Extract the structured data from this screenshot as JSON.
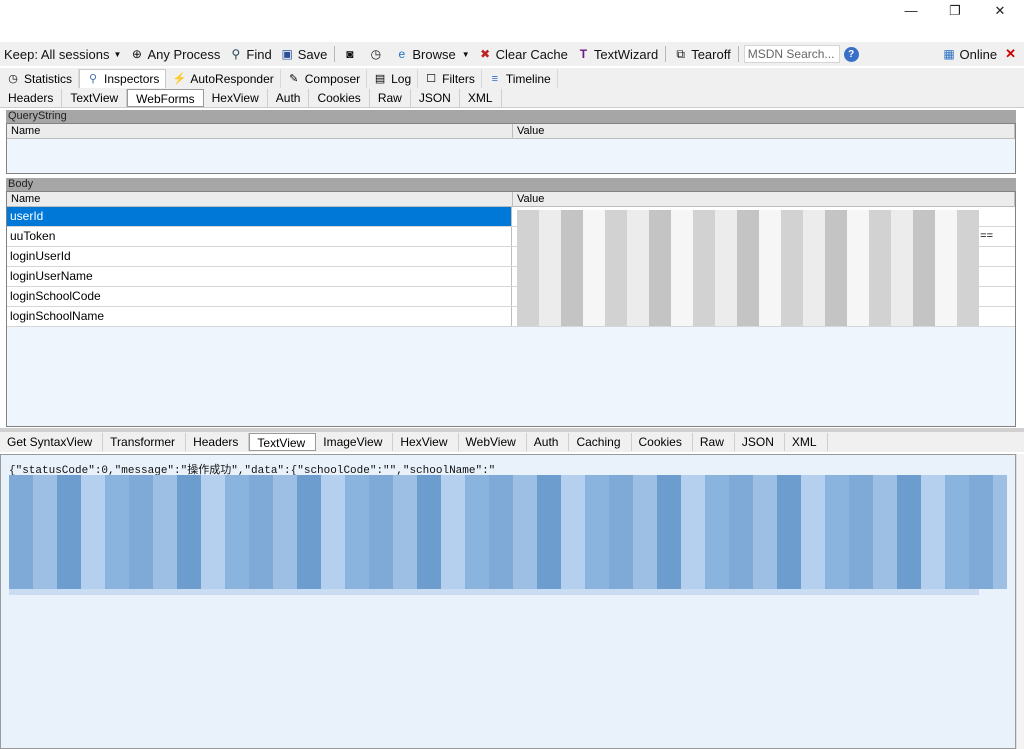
{
  "window": {
    "minimize": "—",
    "restore": "❐",
    "close": "✕"
  },
  "toolbar": {
    "keep": "Keep: All sessions",
    "process": "Any Process",
    "find": "Find",
    "save": "Save",
    "browse": "Browse",
    "clear_cache": "Clear Cache",
    "textwizard": "TextWizard",
    "tearoff": "Tearoff",
    "msdn_placeholder": "MSDN Search...",
    "online": "Online"
  },
  "main_tabs": [
    "Statistics",
    "Inspectors",
    "AutoResponder",
    "Composer",
    "Log",
    "Filters",
    "Timeline"
  ],
  "request_tabs": [
    "Headers",
    "TextView",
    "WebForms",
    "HexView",
    "Auth",
    "Cookies",
    "Raw",
    "JSON",
    "XML"
  ],
  "querystring": {
    "title": "QueryString",
    "col_name": "Name",
    "col_value": "Value"
  },
  "body": {
    "title": "Body",
    "col_name": "Name",
    "col_value": "Value",
    "rows": [
      {
        "name": "userId",
        "value": ""
      },
      {
        "name": "uuToken",
        "value": "=="
      },
      {
        "name": "loginUserId",
        "value": ""
      },
      {
        "name": "loginUserName",
        "value": ""
      },
      {
        "name": "loginSchoolCode",
        "value": ""
      },
      {
        "name": "loginSchoolName",
        "value": ""
      }
    ]
  },
  "response_tabs": [
    "Get SyntaxView",
    "Transformer",
    "Headers",
    "TextView",
    "ImageView",
    "HexView",
    "WebView",
    "Auth",
    "Caching",
    "Cookies",
    "Raw",
    "JSON",
    "XML"
  ],
  "response_text": "{\"statusCode\":0,\"message\":\"操作成功\",\"data\":{\"schoolCode\":\"\",\"schoolName\":\""
}
